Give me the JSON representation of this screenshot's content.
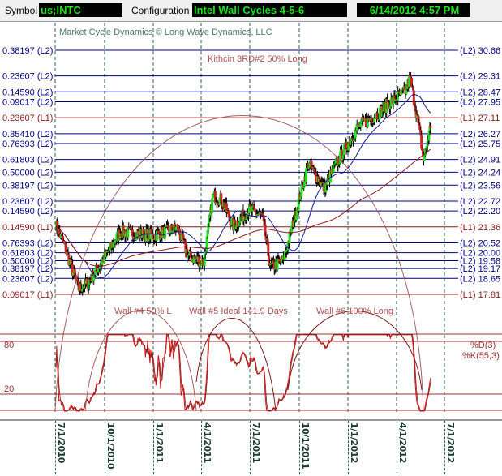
{
  "toolbar": {
    "symbol_label": "Symbol",
    "symbol_value": "us;INTC",
    "config_label": "Configuration",
    "config_value": "Intel Wall Cycles 4-5-6",
    "datetime": "6/14/2012 4:57 PM"
  },
  "chart": {
    "copyright": "Market Cycle Dynamics © Long Wave Dynamics, LLC",
    "kithcin_label": "Kithcin 3RD#2 50% Long",
    "wall_labels": [
      "Wall #4 50% L",
      "Wall #5 Ideal 141.9 Days",
      "Wall #6 100% Long"
    ],
    "levels": [
      {
        "left": "0.38197 (L2)",
        "right": "(L2) 30.66",
        "price": 30.66,
        "type": "L2"
      },
      {
        "left": "0.23607 (L2)",
        "right": "(L2) 29.31",
        "price": 29.31,
        "type": "L2"
      },
      {
        "left": "0.14590 (L2)",
        "right": "(L2) 28.47",
        "price": 28.47,
        "type": "L2"
      },
      {
        "left": "0.09017 (L2)",
        "right": "(L2) 27.95",
        "price": 27.95,
        "type": "L2"
      },
      {
        "left": "0.23607 (L1)",
        "right": "(L1) 27.11",
        "price": 27.11,
        "type": "L1"
      },
      {
        "left": "0.85410 (L2)",
        "right": "(L2) 26.27",
        "price": 26.27,
        "type": "L2"
      },
      {
        "left": "0.76393 (L2)",
        "right": "(L2) 25.75",
        "price": 25.75,
        "type": "L2"
      },
      {
        "left": "0.61803 (L2)",
        "right": "(L2) 24.91",
        "price": 24.91,
        "type": "L2"
      },
      {
        "left": "0.50000 (L2)",
        "right": "(L2) 24.24",
        "price": 24.24,
        "type": "L2"
      },
      {
        "left": "0.38197 (L2)",
        "right": "(L2) 23.56",
        "price": 23.56,
        "type": "L2"
      },
      {
        "left": "0.23607 (L2)",
        "right": "(L2) 22.72",
        "price": 22.72,
        "type": "L2"
      },
      {
        "left": "0.14590 (L2)",
        "right": "(L2) 22.20",
        "price": 22.2,
        "type": "L2"
      },
      {
        "left": "0.14590 (L1)",
        "right": "(L1) 21.36",
        "price": 21.36,
        "type": "L1"
      },
      {
        "left": "0.76393 (L2)",
        "right": "(L2) 20.52",
        "price": 20.52,
        "type": "L2"
      },
      {
        "left": "0.61803 (L2)",
        "right": "(L2) 20.00",
        "price": 20.0,
        "type": "L2"
      },
      {
        "left": "0.50000 (L2)",
        "right": "(L2) 19.58",
        "price": 19.58,
        "type": "L2"
      },
      {
        "left": "0.38197 (L2)",
        "right": "(L2) 19.17",
        "price": 19.17,
        "type": "L2"
      },
      {
        "left": "0.23607 (L2)",
        "right": "(L2) 18.65",
        "price": 18.65,
        "type": "L2"
      },
      {
        "left": "0.09017 (L1)",
        "right": "(L1) 17.81",
        "price": 17.81,
        "type": "L1"
      }
    ],
    "stoch": {
      "level_high": "80",
      "level_low": "20",
      "d_label": "%D(3)",
      "k_label": "%K(55,3)"
    },
    "dates": [
      "7/1/2010",
      "10/1/2010",
      "1/1/2011",
      "4/1/2011",
      "7/1/2011",
      "10/1/2011",
      "1/1/2012",
      "4/1/2012",
      "7/1/2012"
    ],
    "colors": {
      "L2": "#000080",
      "L1": "#8b1a1a",
      "up": "#22dd22",
      "down": "#cc2222",
      "ma_fast": "#1a1a90",
      "ma_slow": "#8b1a1a",
      "stoch": "#cc1111"
    }
  },
  "chart_data": {
    "type": "candlestick",
    "approx_price_path": [
      [
        0,
        21.5
      ],
      [
        10,
        20.5
      ],
      [
        30,
        18.1
      ],
      [
        42,
        18.4
      ],
      [
        62,
        19.6
      ],
      [
        85,
        21.1
      ],
      [
        128,
        20.9
      ],
      [
        160,
        21.3
      ],
      [
        175,
        19.8
      ],
      [
        195,
        19.5
      ],
      [
        207,
        23.0
      ],
      [
        218,
        22.8
      ],
      [
        234,
        21.4
      ],
      [
        255,
        22.3
      ],
      [
        272,
        21.9
      ],
      [
        283,
        19.2
      ],
      [
        300,
        19.6
      ],
      [
        311,
        21.3
      ],
      [
        333,
        24.7
      ],
      [
        354,
        23.4
      ],
      [
        370,
        24.7
      ],
      [
        398,
        26.6
      ],
      [
        424,
        27.3
      ],
      [
        440,
        27.9
      ],
      [
        461,
        28.5
      ],
      [
        467,
        29.2
      ],
      [
        477,
        27.0
      ],
      [
        485,
        24.9
      ],
      [
        494,
        26.7
      ]
    ]
  }
}
